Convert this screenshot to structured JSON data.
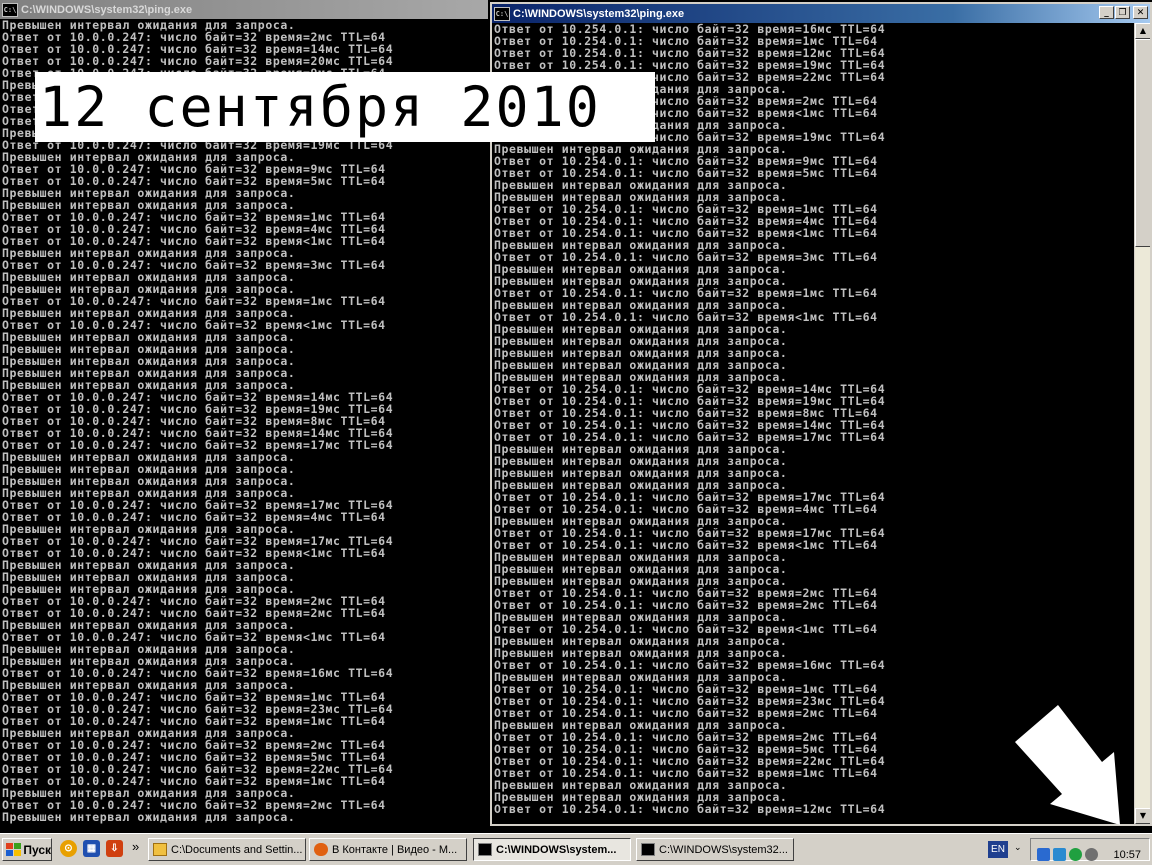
{
  "left_window": {
    "title": "C:\\WINDOWS\\system32\\ping.exe",
    "icon": "cmd-icon",
    "lines": [
      "Превышен интервал ожидания для запроса.",
      "Ответ от 10.0.0.247: число байт=32 время=2мс TTL=64",
      "Ответ от 10.0.0.247: число байт=32 время=14мс TTL=64",
      "Ответ от 10.0.0.247: число байт=32 время=20мс TTL=64",
      "Ответ от 10.0.0.247: число байт=32 время=9мс TTL=64",
      "Превышен интервал ожидания для запроса.",
      "Ответ от 10.0.0.247: число байт=32 время=1мс TTL=64",
      "Ответ от 10.0.0.247: число байт=32 время=4мс TTL=64",
      "Ответ от 10.0.0.247: число байт=32 время<1мс TTL=64",
      "Превышен интервал ожидания для запроса.",
      "Ответ от 10.0.0.247: число байт=32 время=19мс TTL=64",
      "Превышен интервал ожидания для запроса.",
      "Ответ от 10.0.0.247: число байт=32 время=9мс TTL=64",
      "Ответ от 10.0.0.247: число байт=32 время=5мс TTL=64",
      "Превышен интервал ожидания для запроса.",
      "Превышен интервал ожидания для запроса.",
      "Ответ от 10.0.0.247: число байт=32 время=1мс TTL=64",
      "Ответ от 10.0.0.247: число байт=32 время=4мс TTL=64",
      "Ответ от 10.0.0.247: число байт=32 время<1мс TTL=64",
      "Превышен интервал ожидания для запроса.",
      "Ответ от 10.0.0.247: число байт=32 время=3мс TTL=64",
      "Превышен интервал ожидания для запроса.",
      "Превышен интервал ожидания для запроса.",
      "Ответ от 10.0.0.247: число байт=32 время=1мс TTL=64",
      "Превышен интервал ожидания для запроса.",
      "Ответ от 10.0.0.247: число байт=32 время<1мс TTL=64",
      "Превышен интервал ожидания для запроса.",
      "Превышен интервал ожидания для запроса.",
      "Превышен интервал ожидания для запроса.",
      "Превышен интервал ожидания для запроса.",
      "Превышен интервал ожидания для запроса.",
      "Ответ от 10.0.0.247: число байт=32 время=14мс TTL=64",
      "Ответ от 10.0.0.247: число байт=32 время=19мс TTL=64",
      "Ответ от 10.0.0.247: число байт=32 время=8мс TTL=64",
      "Ответ от 10.0.0.247: число байт=32 время=14мс TTL=64",
      "Ответ от 10.0.0.247: число байт=32 время=17мс TTL=64",
      "Превышен интервал ожидания для запроса.",
      "Превышен интервал ожидания для запроса.",
      "Превышен интервал ожидания для запроса.",
      "Превышен интервал ожидания для запроса.",
      "Ответ от 10.0.0.247: число байт=32 время=17мс TTL=64",
      "Ответ от 10.0.0.247: число байт=32 время=4мс TTL=64",
      "Превышен интервал ожидания для запроса.",
      "Ответ от 10.0.0.247: число байт=32 время=17мс TTL=64",
      "Ответ от 10.0.0.247: число байт=32 время<1мс TTL=64",
      "Превышен интервал ожидания для запроса.",
      "Превышен интервал ожидания для запроса.",
      "Превышен интервал ожидания для запроса.",
      "Ответ от 10.0.0.247: число байт=32 время=2мс TTL=64",
      "Ответ от 10.0.0.247: число байт=32 время=2мс TTL=64",
      "Превышен интервал ожидания для запроса.",
      "Ответ от 10.0.0.247: число байт=32 время<1мс TTL=64",
      "Превышен интервал ожидания для запроса.",
      "Превышен интервал ожидания для запроса.",
      "Ответ от 10.0.0.247: число байт=32 время=16мс TTL=64",
      "Превышен интервал ожидания для запроса.",
      "Ответ от 10.0.0.247: число байт=32 время=1мс TTL=64",
      "Ответ от 10.0.0.247: число байт=32 время=23мс TTL=64",
      "Ответ от 10.0.0.247: число байт=32 время=1мс TTL=64",
      "Превышен интервал ожидания для запроса.",
      "Ответ от 10.0.0.247: число байт=32 время=2мс TTL=64",
      "Ответ от 10.0.0.247: число байт=32 время=5мс TTL=64",
      "Ответ от 10.0.0.247: число байт=32 время=22мс TTL=64",
      "Ответ от 10.0.0.247: число байт=32 время=1мс TTL=64",
      "Превышен интервал ожидания для запроса.",
      "Ответ от 10.0.0.247: число байт=32 время=2мс TTL=64",
      "Превышен интервал ожидания для запроса."
    ]
  },
  "right_window": {
    "title": "C:\\WINDOWS\\system32\\ping.exe",
    "icon": "cmd-icon",
    "controls": {
      "minimize": "_",
      "restore": "❐",
      "close": "✕"
    },
    "scroll": {
      "up": "▲",
      "down": "▼"
    },
    "lines": [
      "Ответ от 10.254.0.1: число байт=32 время=16мс TTL=64",
      "Ответ от 10.254.0.1: число байт=32 время=1мс TTL=64",
      "Ответ от 10.254.0.1: число байт=32 время=12мс TTL=64",
      "Ответ от 10.254.0.1: число байт=32 время=19мс TTL=64",
      "Ответ от 10.254.0.1: число байт=32 время=22мс TTL=64",
      "Превышен интервал ожидания для запроса.",
      "Ответ от 10.254.0.1: число байт=32 время=2мс TTL=64",
      "Ответ от 10.254.0.1: число байт=32 время<1мс TTL=64",
      "Превышен интервал ожидания для запроса.",
      "Ответ от 10.254.0.1: число байт=32 время=19мс TTL=64",
      "Превышен интервал ожидания для запроса.",
      "Ответ от 10.254.0.1: число байт=32 время=9мс TTL=64",
      "Ответ от 10.254.0.1: число байт=32 время=5мс TTL=64",
      "Превышен интервал ожидания для запроса.",
      "Превышен интервал ожидания для запроса.",
      "Ответ от 10.254.0.1: число байт=32 время=1мс TTL=64",
      "Ответ от 10.254.0.1: число байт=32 время=4мс TTL=64",
      "Ответ от 10.254.0.1: число байт=32 время<1мс TTL=64",
      "Превышен интервал ожидания для запроса.",
      "Ответ от 10.254.0.1: число байт=32 время=3мс TTL=64",
      "Превышен интервал ожидания для запроса.",
      "Превышен интервал ожидания для запроса.",
      "Ответ от 10.254.0.1: число байт=32 время=1мс TTL=64",
      "Превышен интервал ожидания для запроса.",
      "Ответ от 10.254.0.1: число байт=32 время<1мс TTL=64",
      "Превышен интервал ожидания для запроса.",
      "Превышен интервал ожидания для запроса.",
      "Превышен интервал ожидания для запроса.",
      "Превышен интервал ожидания для запроса.",
      "Превышен интервал ожидания для запроса.",
      "Ответ от 10.254.0.1: число байт=32 время=14мс TTL=64",
      "Ответ от 10.254.0.1: число байт=32 время=19мс TTL=64",
      "Ответ от 10.254.0.1: число байт=32 время=8мс TTL=64",
      "Ответ от 10.254.0.1: число байт=32 время=14мс TTL=64",
      "Ответ от 10.254.0.1: число байт=32 время=17мс TTL=64",
      "Превышен интервал ожидания для запроса.",
      "Превышен интервал ожидания для запроса.",
      "Превышен интервал ожидания для запроса.",
      "Превышен интервал ожидания для запроса.",
      "Ответ от 10.254.0.1: число байт=32 время=17мс TTL=64",
      "Ответ от 10.254.0.1: число байт=32 время=4мс TTL=64",
      "Превышен интервал ожидания для запроса.",
      "Ответ от 10.254.0.1: число байт=32 время=17мс TTL=64",
      "Ответ от 10.254.0.1: число байт=32 время<1мс TTL=64",
      "Превышен интервал ожидания для запроса.",
      "Превышен интервал ожидания для запроса.",
      "Превышен интервал ожидания для запроса.",
      "Ответ от 10.254.0.1: число байт=32 время=2мс TTL=64",
      "Ответ от 10.254.0.1: число байт=32 время=2мс TTL=64",
      "Превышен интервал ожидания для запроса.",
      "Ответ от 10.254.0.1: число байт=32 время<1мс TTL=64",
      "Превышен интервал ожидания для запроса.",
      "Превышен интервал ожидания для запроса.",
      "Ответ от 10.254.0.1: число байт=32 время=16мс TTL=64",
      "Превышен интервал ожидания для запроса.",
      "Ответ от 10.254.0.1: число байт=32 время=1мс TTL=64",
      "Ответ от 10.254.0.1: число байт=32 время=23мс TTL=64",
      "Ответ от 10.254.0.1: число байт=32 время=2мс TTL=64",
      "Превышен интервал ожидания для запроса.",
      "Ответ от 10.254.0.1: число байт=32 время=2мс TTL=64",
      "Ответ от 10.254.0.1: число байт=32 время=5мс TTL=64",
      "Ответ от 10.254.0.1: число байт=32 время=22мс TTL=64",
      "Ответ от 10.254.0.1: число байт=32 время=1мс TTL=64",
      "Превышен интервал ожидания для запроса.",
      "Превышен интервал ожидания для запроса.",
      "Ответ от 10.254.0.1: число байт=32 время=12мс TTL=64"
    ]
  },
  "date_banner": "12 сентября 2010",
  "taskbar": {
    "start_label": "Пуск",
    "more_glyph": "»",
    "tasks": [
      {
        "label": "C:\\Documents and Settin...",
        "icon": "folder-icon",
        "active": false
      },
      {
        "label": "В Контакте | Видео - M...",
        "icon": "firefox-icon",
        "active": false
      },
      {
        "label": "C:\\WINDOWS\\system...",
        "icon": "cmd-icon",
        "active": true
      },
      {
        "label": "C:\\WINDOWS\\system32...",
        "icon": "cmd-icon",
        "active": false
      }
    ],
    "language": "EN",
    "clock": "10:57"
  },
  "colors": {
    "console_text": "#c0c0c0",
    "active_title": "#0a246a",
    "inactive_title": "#808080",
    "taskbar": "#d4d0c8"
  }
}
